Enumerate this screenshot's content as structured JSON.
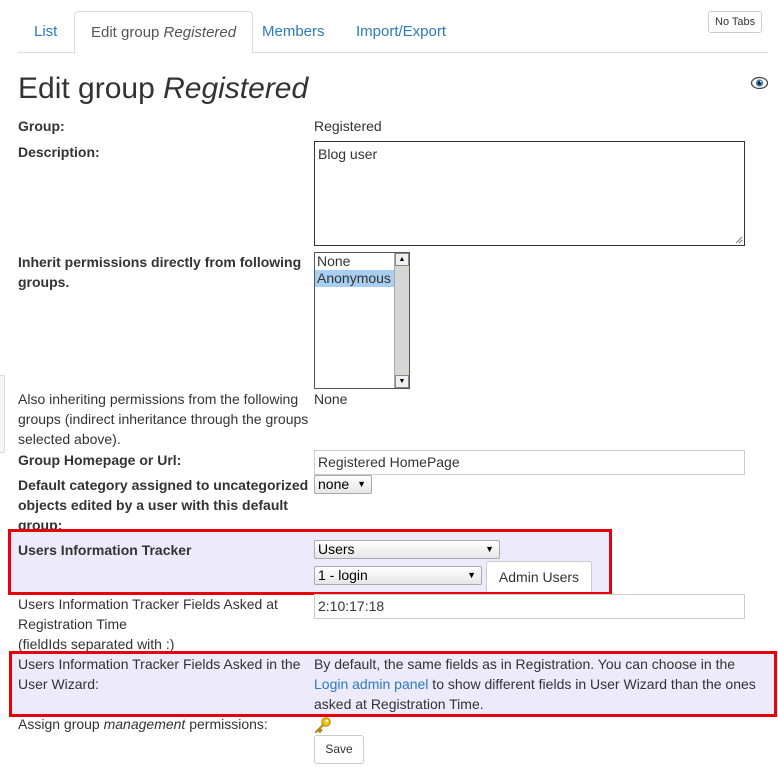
{
  "tabs": [
    {
      "label": "List"
    },
    {
      "label_prefix": "Edit group ",
      "label_em": "Registered"
    },
    {
      "label": "Members"
    },
    {
      "label": "Import/Export"
    }
  ],
  "no_tabs_label": "No Tabs",
  "page_title": {
    "prefix": "Edit group ",
    "em": "Registered"
  },
  "icons": {
    "view": "eye-icon",
    "permissions": "key-icon"
  },
  "form": {
    "group_label": "Group:",
    "group_value": "Registered",
    "description_label": "Description:",
    "description_value": "Blog user",
    "inherit_label": "Inherit permissions directly from following groups.",
    "inherit_options": [
      {
        "label": "None",
        "selected": false
      },
      {
        "label": "Anonymous",
        "selected": true
      }
    ],
    "also_inherit_label": "Also inheriting permissions from the following groups (indirect inheritance through the groups selected above).",
    "also_inherit_value": "None",
    "homepage_label": "Group Homepage or Url:",
    "homepage_value": "Registered HomePage",
    "default_category_label": "Default category assigned to uncategorized objects edited by a user with this default group:",
    "default_category_value": "none",
    "tracker_label": "Users Information Tracker",
    "tracker_value": "Users",
    "tracker_field_value": "1 - login",
    "admin_users_label": "Admin Users",
    "registration_fields_label_1": "Users Information Tracker Fields Asked at Registration Time",
    "registration_fields_label_2": "(fieldIds separated with :)",
    "registration_fields_value": "2:10:17:18",
    "wizard_label": "Users Information Tracker Fields Asked in the User Wizard:",
    "wizard_text_1": "By default, the same fields as in Registration. You can choose in the",
    "wizard_link": "Login admin panel",
    "wizard_text_2": " to show different fields in User Wizard than the ones asked at Registration Time.",
    "assign_prefix": "Assign group ",
    "assign_em": "management",
    "assign_suffix": " permissions:",
    "save_label": "Save"
  },
  "colors": {
    "accent": "#2a7bbf",
    "highlight": "#eceafb",
    "red_outline": "#e8000b",
    "selected_option": "#a9cff0"
  }
}
